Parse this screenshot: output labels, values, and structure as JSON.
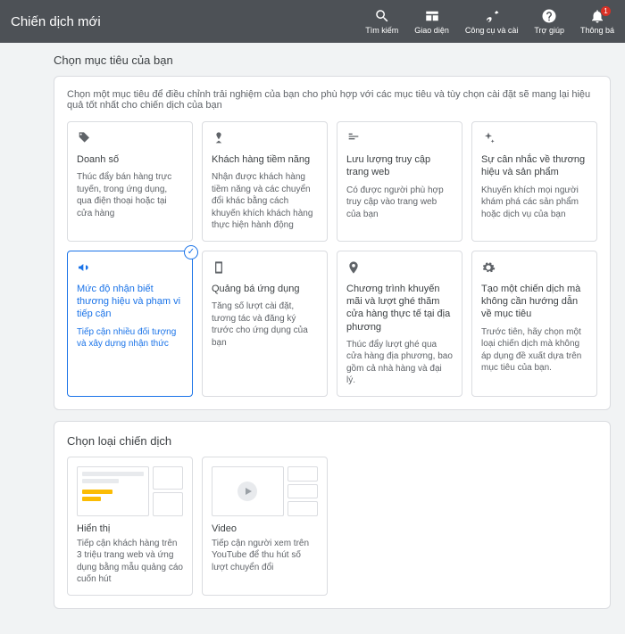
{
  "header": {
    "title": "Chiến dịch mới",
    "nav": [
      {
        "label": "Tìm kiếm"
      },
      {
        "label": "Giao diện"
      },
      {
        "label": "Công cụ và cài"
      },
      {
        "label": "Trợ giúp"
      },
      {
        "label": "Thông bá",
        "badge": "1"
      }
    ]
  },
  "objective": {
    "title": "Chọn mục tiêu của bạn",
    "intro": "Chọn một mục tiêu để điều chỉnh trải nghiệm của bạn cho phù hợp với các mục tiêu và tùy chọn cài đặt sẽ mang lại hiệu quả tốt nhất cho chiến dịch của bạn",
    "tiles": [
      {
        "title": "Doanh số",
        "desc": "Thúc đẩy bán hàng trực tuyến, trong ứng dụng, qua điện thoại hoặc tại cửa hàng"
      },
      {
        "title": "Khách hàng tiềm năng",
        "desc": "Nhận được khách hàng tiềm năng và các chuyển đổi khác bằng cách khuyến khích khách hàng thực hiện hành động"
      },
      {
        "title": "Lưu lượng truy cập trang web",
        "desc": "Có được người phù hợp truy cập vào trang web của bạn"
      },
      {
        "title": "Sự cân nhắc về thương hiệu và sản phẩm",
        "desc": "Khuyến khích mọi người khám phá các sản phẩm hoặc dịch vụ của bạn"
      },
      {
        "title": "Mức độ nhận biết thương hiệu và phạm vi tiếp cận",
        "desc": "Tiếp cận nhiều đối tượng và xây dựng nhận thức"
      },
      {
        "title": "Quảng bá ứng dụng",
        "desc": "Tăng số lượt cài đặt, tương tác và đăng ký trước cho ứng dụng của bạn"
      },
      {
        "title": "Chương trình khuyến mãi và lượt ghé thăm cửa hàng thực tế tại địa phương",
        "desc": "Thúc đẩy lượt ghé qua cửa hàng địa phương, bao gồm cả nhà hàng và đại lý."
      },
      {
        "title": "Tạo một chiến dịch mà không cần hướng dẫn về mục tiêu",
        "desc": "Trước tiên, hãy chọn một loại chiến dịch mà không áp dụng đề xuất dựa trên mục tiêu của bạn."
      }
    ]
  },
  "campaignType": {
    "title": "Chọn loại chiến dịch",
    "tiles": [
      {
        "title": "Hiển thị",
        "desc": "Tiếp cận khách hàng trên 3 triệu trang web và ứng dụng bằng mẫu quảng cáo cuốn hút"
      },
      {
        "title": "Video",
        "desc": "Tiếp cận người xem trên YouTube để thu hút số lượt chuyển đổi"
      }
    ]
  }
}
